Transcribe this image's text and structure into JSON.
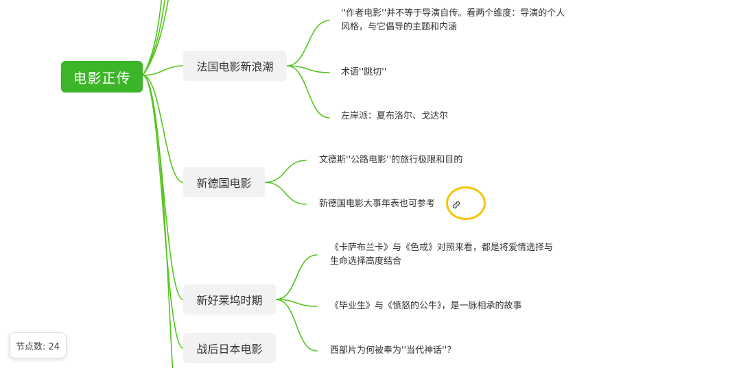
{
  "mindmap": {
    "root": {
      "label": "电影正传"
    },
    "branches": [
      {
        "label": "法国电影新浪潮",
        "children": [
          {
            "lines": [
              "''作者电影''并不等于导演自传。看两个维度：导演的个人",
              "风格，与它倡导的主题和内涵"
            ]
          },
          {
            "lines": [
              "术语''跳切''"
            ]
          },
          {
            "lines": [
              "左岸派：夏布洛尔、戈达尔"
            ]
          }
        ]
      },
      {
        "label": "新德国电影",
        "children": [
          {
            "lines": [
              "文德斯''公路电影''的旅行极限和目的"
            ]
          },
          {
            "lines": [
              "新德国电影大事年表也可参考"
            ],
            "has_link": true
          }
        ]
      },
      {
        "label": "新好莱坞时期",
        "children": [
          {
            "lines": [
              "《卡萨布兰卡》与《色戒》对照来看，都是将爱情选择与",
              "生命选择高度结合"
            ]
          },
          {
            "lines": [
              "《毕业生》与《愤怒的公牛》，是一脉相承的故事"
            ]
          },
          {
            "lines": [
              "西部片为何被奉为''当代神话''?"
            ]
          }
        ]
      },
      {
        "label": "战后日本电影",
        "children": []
      }
    ]
  },
  "link_icon": "link-icon",
  "status": {
    "node_count_label": "节点数: 24"
  },
  "colors": {
    "root_fill": "#3cb528",
    "connector": "#52c41a",
    "branch_fill": "#f2f2f2",
    "highlight_ring": "#f5c400"
  }
}
